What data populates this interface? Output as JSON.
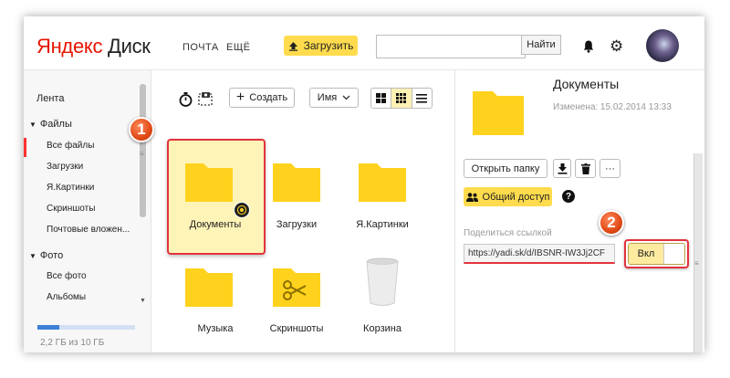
{
  "header": {
    "logo_brand": "Яндекс",
    "logo_product": "Диск",
    "nav_mail": "ПОЧТА",
    "nav_more": "ЕЩЁ",
    "upload_label": "Загрузить",
    "search_value": "",
    "search_button": "Найти",
    "icons": [
      "upload-icon",
      "bell-icon",
      "gear-icon",
      "avatar"
    ]
  },
  "sidebar": {
    "feed": "Лента",
    "files_section": "Файлы",
    "files_items": [
      "Все файлы",
      "Загрузки",
      "Я.Картинки",
      "Скриншоты",
      "Почтовые вложен..."
    ],
    "photo_section": "Фото",
    "photo_items": [
      "Все фото",
      "Альбомы"
    ],
    "storage_text": "2,2 ГБ из 10 ГБ",
    "storage_used_fraction": 0.22
  },
  "toolbar": {
    "create_label": "Создать",
    "sort_label": "Имя",
    "views": [
      "tile-large",
      "tile-small",
      "list"
    ],
    "active_view": "tile-small"
  },
  "files": [
    {
      "name": "Документы",
      "type": "folder",
      "shared": true,
      "selected": true
    },
    {
      "name": "Загрузки",
      "type": "folder"
    },
    {
      "name": "Я.Картинки",
      "type": "folder"
    },
    {
      "name": "Музыка",
      "type": "folder"
    },
    {
      "name": "Скриншоты",
      "type": "folder-scissors"
    },
    {
      "name": "Корзина",
      "type": "trash"
    }
  ],
  "details": {
    "title": "Документы",
    "modified": "Изменена: 15.02.2014 13:33",
    "open_folder_label": "Открыть папку",
    "more_label": "···",
    "shared_access_label": "Общий доступ",
    "help_label": "?",
    "share_link_label": "Поделиться ссылкой",
    "share_link_value": "https://yadi.sk/d/IBSNR-IW3Jj2CF",
    "toggle_label": "Вкл",
    "toggle_on": true
  },
  "callouts": [
    "1",
    "2"
  ],
  "colors": {
    "accent_yellow": "#ffdb4d",
    "folder_yellow": "#ffd21e",
    "highlight_red": "#e3323d",
    "active_red": "#ff3333",
    "progress_blue": "#3e80d6"
  }
}
